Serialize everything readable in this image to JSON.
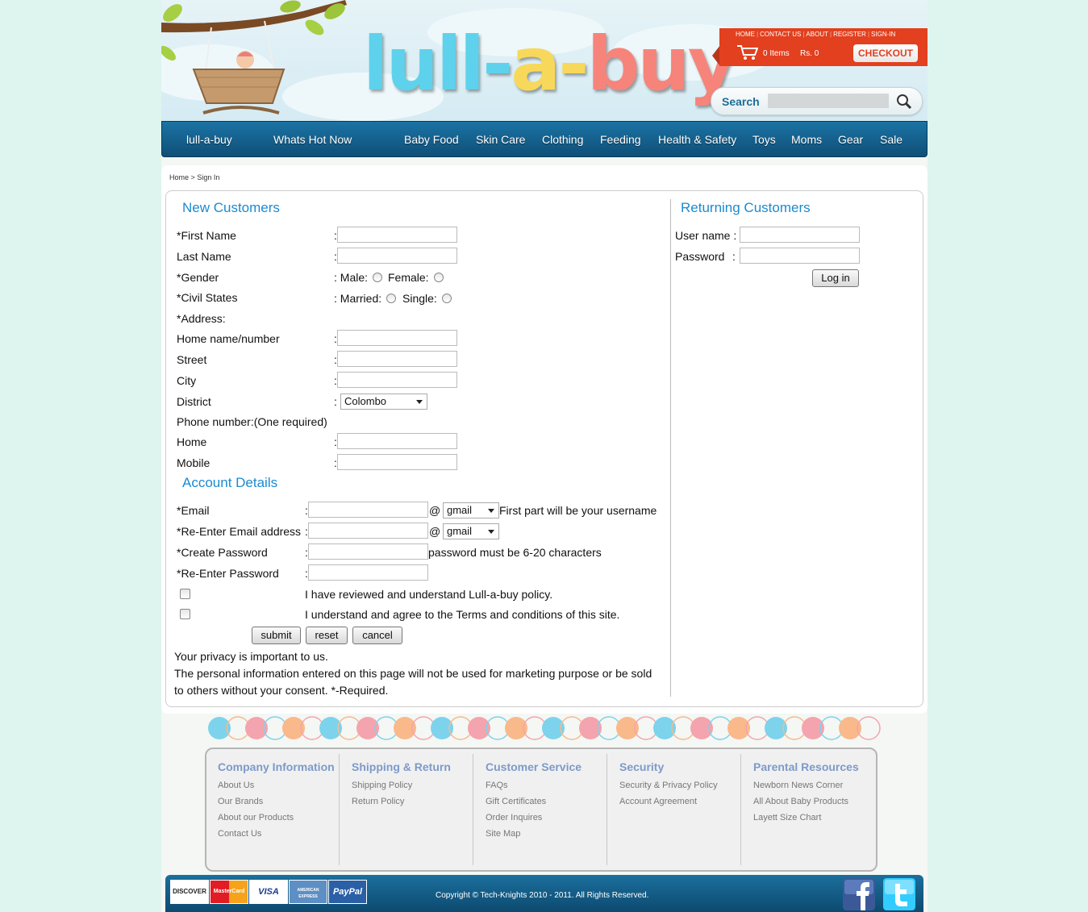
{
  "brand": {
    "logo_part1": "lull-",
    "logo_part2": "a-",
    "logo_part3": "buy"
  },
  "header": {
    "top_links": [
      "HOME",
      "CONTACT US",
      "ABOUT",
      "REGISTER",
      "SIGN-IN"
    ],
    "cart_items": "0 Items",
    "cart_total": "Rs. 0",
    "checkout_label": "CHECKOUT",
    "search_label": "Search"
  },
  "nav": {
    "items": [
      "lull-a-buy",
      "Whats Hot Now",
      "Baby Food",
      "Skin Care",
      "Clothing",
      "Feeding",
      "Health & Safety",
      "Toys",
      "Moms",
      "Gear",
      "Sale"
    ]
  },
  "breadcrumb": {
    "home": "Home",
    "sep": ">",
    "current": "Sign In"
  },
  "new_customers": {
    "title": "New Customers",
    "first_name": "*First Name",
    "last_name": "Last Name",
    "gender": "*Gender",
    "male": ": Male:",
    "female": "Female:",
    "civil": "*Civil States",
    "married": ": Married:",
    "single": "Single:",
    "address": "*Address:",
    "home_name": "Home name/number",
    "street": "Street",
    "city": "City",
    "district": "District",
    "district_value": "Colombo",
    "phone": "Phone number:(One required)",
    "home_phone": "Home",
    "mobile": "Mobile"
  },
  "account": {
    "title": "Account Details",
    "email": "*Email",
    "email_domain": "gmail",
    "email_hint": "First part will be your username",
    "reemail": "*Re-Enter Email address",
    "reemail_domain": "gmail",
    "password": "*Create Password",
    "password_hint": "password must be 6-20 characters",
    "repassword": "*Re-Enter Password",
    "agree1": "I have reviewed and understand Lull-a-buy policy.",
    "agree2": "I understand and agree to the Terms and conditions of this site.",
    "submit": "submit",
    "reset": "reset",
    "cancel": "cancel",
    "privacy1": "Your privacy is important to us.",
    "privacy2": "The personal information entered on this page will not be used for marketing purpose or be sold",
    "privacy3": "to others without your consent. *-Required."
  },
  "returning": {
    "title": "Returning Customers",
    "username": "User name :",
    "password": "Password",
    "password_colon": ":",
    "login": "Log in"
  },
  "footer": {
    "columns": [
      {
        "title": "Company Information",
        "links": [
          "About Us",
          "Our Brands",
          "About our Products",
          "Contact Us"
        ]
      },
      {
        "title": "Shipping & Return",
        "links": [
          "Shipping Policy",
          "Return Policy"
        ]
      },
      {
        "title": "Customer Service",
        "links": [
          "FAQs",
          "Gift Certificates",
          "Order Inquires",
          "Site Map"
        ]
      },
      {
        "title": "Security",
        "links": [
          "Security & Privacy Policy",
          "Account Agreement"
        ]
      },
      {
        "title": "Parental Resources",
        "links": [
          "Newborn News Corner",
          "All About Baby Products",
          "Layett Size Chart"
        ]
      }
    ],
    "cards": [
      "DISCOVER",
      "MasterCard",
      "VISA",
      "AMERICAN EXPRESS",
      "PayPal"
    ],
    "copyright": "Copyright © Tech-Knights 2010 - 2011. All Rights Reserved."
  },
  "colors": {
    "accent": "#1c8ad0",
    "nav": "#1b73a4",
    "topbar": "#e2401e",
    "footer_head": "#7d9ac9"
  },
  "icons": {
    "cart": "shopping-cart-icon",
    "search": "magnifier-icon",
    "facebook": "facebook-icon",
    "twitter": "twitter-icon"
  }
}
